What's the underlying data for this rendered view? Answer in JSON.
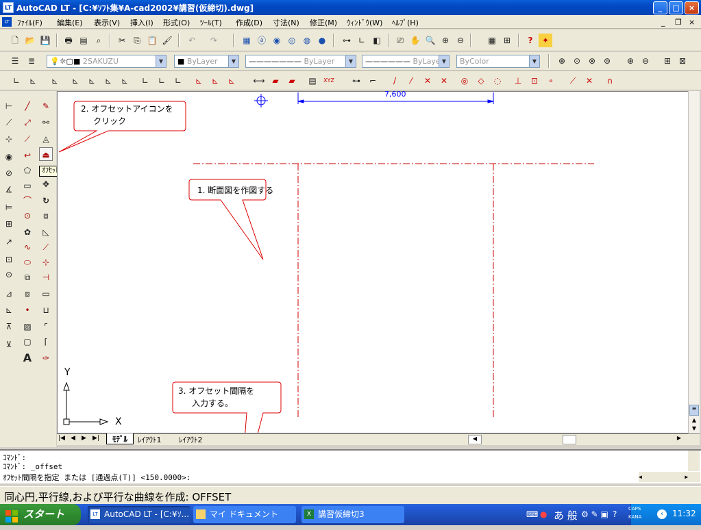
{
  "window": {
    "title": "AutoCAD LT - [C:¥ｿﾌﾄ集¥A-cad2002¥講習(仮締切).dwg]",
    "app_icon": "LT"
  },
  "menubar": {
    "items": [
      "ﾌｧｲﾙ(F)",
      "編集(E)",
      "表示(V)",
      "挿入(I)",
      "形式(O)",
      "ﾂｰﾙ(T)",
      "作成(D)",
      "寸法(N)",
      "修正(M)",
      "ｳｨﾝﾄﾞｳ(W)",
      "ﾍﾙﾌﾟ(H)"
    ]
  },
  "toolbars": {
    "layer_combo": "2SAKUZU",
    "color_combo": "ByLayer",
    "linetype_combo": "ByLayer",
    "lineweight_combo": "ByLayer",
    "plotstyle_combo": "ByColor"
  },
  "tooltip": {
    "offset": "ｵﾌｾｯﾄ"
  },
  "drawing": {
    "dimension_text": "7,600",
    "ucs_y": "Y",
    "ucs_x": "X"
  },
  "callouts": {
    "c1": "1. 断面図を作図する",
    "c2_line1": "2. オフセットアイコンを",
    "c2_line2": "クリック",
    "c3_line1": "3. オフセット間隔を",
    "c3_line2": "入力する。"
  },
  "layout_tabs": [
    "ﾓﾃﾞﾙ",
    "ﾚｲｱｳﾄ1",
    "ﾚｲｱｳﾄ2"
  ],
  "command": {
    "line1": "ｺﾏﾝﾄﾞ:",
    "line2": "ｺﾏﾝﾄﾞ: _offset",
    "line3": "ｵﾌｾｯﾄ間隔を指定 または [通過点(T)] <150.0000>:"
  },
  "status": {
    "text": "同心円,平行線,および平行な曲線を作成:  OFFSET"
  },
  "taskbar": {
    "start": "スタート",
    "tasks": [
      "AutoCAD LT - [C:¥ｿ...",
      "マイ ドキュメント",
      "講習仮締切3"
    ],
    "ime": "あ 般",
    "caps": "CAPS",
    "kana": "KANA",
    "clock": "11:32"
  },
  "colors": {
    "dim_blue": "#0000ff",
    "centerline_red": "#cc0000",
    "callout_red": "#dd0000"
  }
}
